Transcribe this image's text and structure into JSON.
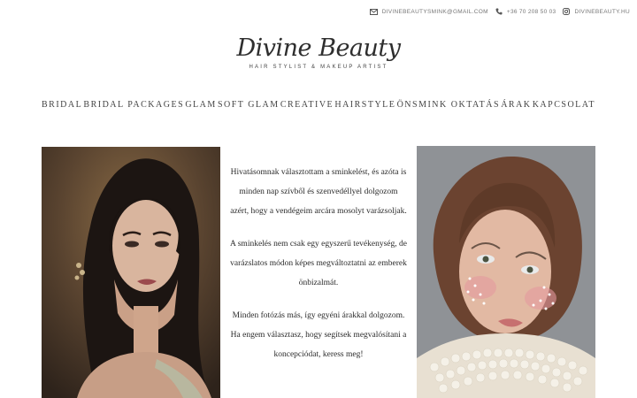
{
  "topbar": {
    "email": "DIVINEBEAUTYSMINK@GMAIL.COM",
    "phone": "+36 70 208 50 03",
    "instagram": "DIVINEBEAUTY.HU",
    "icons": [
      "mail-icon",
      "phone-icon",
      "instagram-icon"
    ]
  },
  "logo": {
    "brand": "Divine Beauty",
    "tagline": "HAIR STYLIST & MAKEUP ARTIST"
  },
  "nav": {
    "items": [
      "BRIDAL",
      "BRIDAL PACKAGES",
      "GLAM",
      "SOFT GLAM",
      "CREATIVE",
      "HAIRSTYLE",
      "ÖNSMINK OKTATÁS",
      "ÁRAK",
      "KAPCSOLAT"
    ]
  },
  "content": {
    "paragraphs": [
      "Hivatásomnak választottam a sminkelést, és azóta is minden nap szívből és szenvedéllyel dolgozom azért, hogy a vendégeim arcára mosolyt varázsoljak.",
      "A sminkelés nem csak egy egyszerű tevékenység, de varázslatos módon képes megváltoztatni az emberek önbizalmát.",
      "Minden fotózás más, így egyéni árakkal dolgozom. Ha engem választasz, hogy segítsek megvalósítani a koncepciódat, keress meg!"
    ]
  },
  "colors": {
    "text": "#333333",
    "muted": "#777777",
    "background": "#ffffff"
  }
}
